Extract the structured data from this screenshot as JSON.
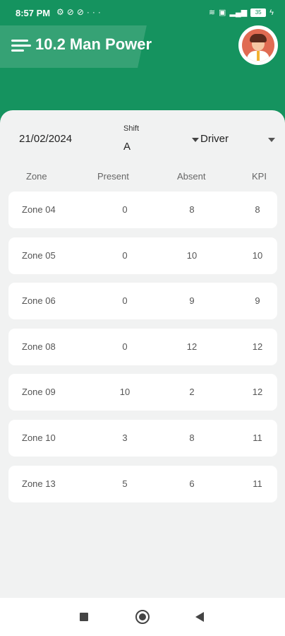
{
  "status_bar": {
    "time": "8:57 PM",
    "left_icons": [
      "gear-icon",
      "sync-icon",
      "sync-icon",
      "more-icon"
    ],
    "right_icons": [
      "wifi-icon",
      "sim-icon",
      "signal-icon",
      "battery-icon",
      "charging-icon"
    ],
    "battery": "35"
  },
  "app_bar": {
    "title": "10.2 Man Power"
  },
  "filters": {
    "date": "21/02/2024",
    "shift_label": "Shift",
    "shift_value": "A",
    "role": "Driver"
  },
  "table": {
    "headers": {
      "zone": "Zone",
      "present": "Present",
      "absent": "Absent",
      "kpi": "KPI"
    },
    "rows": [
      {
        "zone": "Zone 04",
        "present": "0",
        "absent": "8",
        "kpi": "8"
      },
      {
        "zone": "Zone 05",
        "present": "0",
        "absent": "10",
        "kpi": "10"
      },
      {
        "zone": "Zone 06",
        "present": "0",
        "absent": "9",
        "kpi": "9"
      },
      {
        "zone": "Zone 08",
        "present": "0",
        "absent": "12",
        "kpi": "12"
      },
      {
        "zone": "Zone 09",
        "present": "10",
        "absent": "2",
        "kpi": "12"
      },
      {
        "zone": "Zone 10",
        "present": "3",
        "absent": "8",
        "kpi": "11"
      },
      {
        "zone": "Zone 13",
        "present": "5",
        "absent": "6",
        "kpi": "11"
      }
    ]
  },
  "colors": {
    "primary": "#15935f",
    "background": "#f0f1f1",
    "card": "#ffffff"
  }
}
